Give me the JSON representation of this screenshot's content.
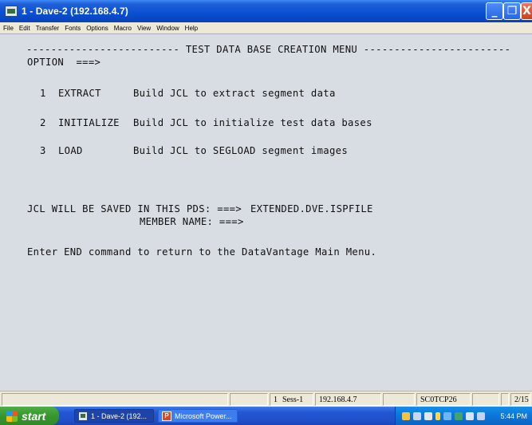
{
  "window": {
    "title": "1 - Dave-2 (192.168.4.7)",
    "min_glyph": "_",
    "max_glyph": "❐",
    "close_glyph": "X"
  },
  "menubar": {
    "items": [
      "File",
      "Edit",
      "Transfer",
      "Fonts",
      "Options",
      "Macro",
      "View",
      "Window",
      "Help"
    ]
  },
  "terminal": {
    "header_line": "------------------------- TEST DATA BASE CREATION MENU ------------------------",
    "option_prompt": "OPTION  ===>",
    "options": [
      {
        "number": "1",
        "name": "EXTRACT",
        "description": "Build JCL to extract segment data"
      },
      {
        "number": "2",
        "name": "INITIALIZE",
        "description": "Build JCL to initialize test data bases"
      },
      {
        "number": "3",
        "name": "LOAD",
        "description": "Build JCL to SEGLOAD segment images"
      }
    ],
    "pds_label": "JCL WILL BE SAVED IN THIS PDS: ===>",
    "pds_value": "EXTENDED.DVE.ISPFILE",
    "member_label": "MEMBER NAME: ===>",
    "member_value": "",
    "footer_message": "Enter END command to return to the DataVantage Main Menu."
  },
  "statusbar": {
    "session_num": "1",
    "session": "Sess-1",
    "host": "192.168.4.7",
    "lu": "SC0TCP26",
    "cursor": "2/15"
  },
  "taskbar": {
    "start_label": "start",
    "tasks": [
      {
        "label": "1 - Dave-2 (192...",
        "icon": "tn3270-icon",
        "active": true
      },
      {
        "label": "Microsoft Power...",
        "icon": "powerpoint-icon",
        "active": false
      }
    ],
    "clock": "5:44 PM"
  },
  "colors": {
    "terminal_bg": "#d7dde3",
    "terminal_fg": "#101010",
    "titlebar": "#0a4fd3",
    "start_green": "#39982f"
  }
}
